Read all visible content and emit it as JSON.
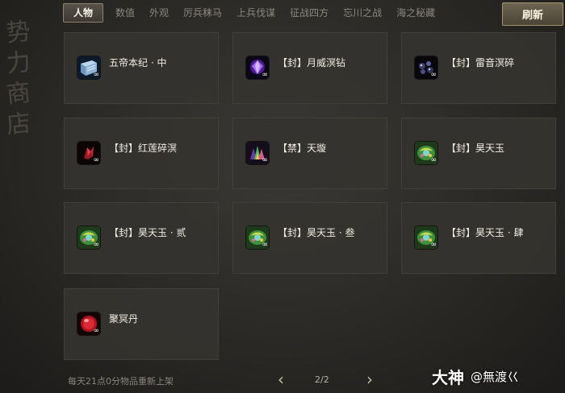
{
  "side_title": [
    "势",
    "力",
    "商",
    "店"
  ],
  "tabs": [
    {
      "label": "人物",
      "active": true
    },
    {
      "label": "数值",
      "active": false
    },
    {
      "label": "外观",
      "active": false
    },
    {
      "label": "厉兵秣马",
      "active": false
    },
    {
      "label": "上兵伐谋",
      "active": false
    },
    {
      "label": "征战四方",
      "active": false
    },
    {
      "label": "忘川之战",
      "active": false
    },
    {
      "label": "海之秘藏",
      "active": false
    }
  ],
  "refresh_label": "刷新",
  "items": [
    {
      "name": "五帝本纪 · 中",
      "icon": "book-icon",
      "badge": "∞"
    },
    {
      "name": "【封】月威溟钻",
      "icon": "purple-gem-icon",
      "badge": "∞"
    },
    {
      "name": "【封】雷音溟碎",
      "icon": "dark-shards-icon",
      "badge": "∞"
    },
    {
      "name": "【封】红莲碎溟",
      "icon": "red-shard-icon",
      "badge": "∞"
    },
    {
      "name": "【禁】天璇",
      "icon": "crystal-cluster-icon",
      "badge": "∞"
    },
    {
      "name": "【封】昊天玉",
      "icon": "jade-icon",
      "badge": "∞"
    },
    {
      "name": "【封】昊天玉 · 贰",
      "icon": "jade-icon",
      "badge": "∞"
    },
    {
      "name": "【封】昊天玉 · 叁",
      "icon": "jade-icon",
      "badge": "∞"
    },
    {
      "name": "【封】昊天玉 · 肆",
      "icon": "jade-icon",
      "badge": "∞"
    },
    {
      "name": "聚冥丹",
      "icon": "red-pill-icon",
      "badge": "∞"
    }
  ],
  "footer_note": "每天21点0分物品重新上架",
  "pager": {
    "prev": "‹",
    "next": "›",
    "page": "2/2"
  },
  "watermark": {
    "brand": "大神",
    "handle": "@無渡巜"
  }
}
